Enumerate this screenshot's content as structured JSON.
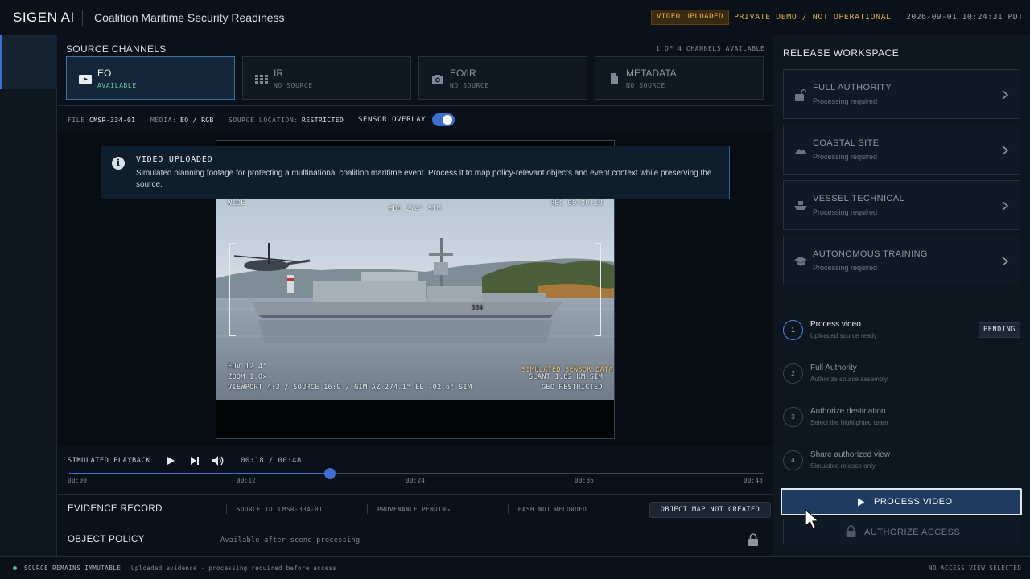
{
  "header": {
    "brand": "SIGEN AI",
    "title": "Coalition Maritime Security Readiness",
    "status_badge": "VIDEO UPLOADED",
    "demo_label": "PRIVATE DEMO / NOT OPERATIONAL",
    "timestamp": "2026-09-01 10:24:31 PDT"
  },
  "channels": {
    "title": "SOURCE CHANNELS",
    "available": "1 OF 4 CHANNELS AVAILABLE",
    "items": [
      {
        "name": "EO",
        "status": "AVAILABLE",
        "icon": "video-icon"
      },
      {
        "name": "IR",
        "status": "NO SOURCE",
        "icon": "grid-icon"
      },
      {
        "name": "EO/IR",
        "status": "NO SOURCE",
        "icon": "camera-icon"
      },
      {
        "name": "METADATA",
        "status": "NO SOURCE",
        "icon": "document-icon"
      }
    ]
  },
  "infobar": {
    "file_label": "FILE",
    "file": "CMSR-334-01",
    "media_label": "MEDIA:",
    "media": "EO / RGB",
    "location_label": "SOURCE LOCATION:",
    "location": "RESTRICTED",
    "overlay_label": "SENSOR OVERLAY",
    "overlay_on": true
  },
  "notice": {
    "title": "VIDEO UPLOADED",
    "body": "Simulated planning footage for protecting a multinational coalition maritime event. Process it to map policy-relevant objects and event context while preserving the source."
  },
  "hud": {
    "top_left": "WIDE",
    "top_center": "HDG 274° SIM",
    "top_right": "REC 00:00:18",
    "fov": "FOV 12.4°",
    "zoom": "ZOOM 1.0×",
    "viewport": "VIEWPORT 4:3 / SOURCE 16:9 / GIM AZ 274.1° EL -02.6° SIM",
    "sim_data": "SIMULATED SENSOR DATA",
    "slant": "SLANT 1.82 KM SIM",
    "geo": "GEO RESTRICTED",
    "hull_number": "334"
  },
  "playback": {
    "label": "SIMULATED PLAYBACK",
    "time": "00:18 / 00:48",
    "progress": 0.375,
    "ticks": [
      "00:00",
      "00:12",
      "00:24",
      "00:36",
      "00:48"
    ]
  },
  "evidence": {
    "title": "EVIDENCE RECORD",
    "source_id_label": "SOURCE ID",
    "source_id": "CMSR-334-01",
    "provenance": "PROVENANCE PENDING",
    "hash": "HASH NOT RECORDED",
    "badge": "OBJECT MAP NOT CREATED"
  },
  "policy": {
    "title": "OBJECT POLICY",
    "note": "Available after scene processing"
  },
  "workspace": {
    "title": "RELEASE WORKSPACE",
    "cards": [
      {
        "name": "FULL AUTHORITY",
        "sub": "Processing required",
        "icon": "unlock-icon"
      },
      {
        "name": "COASTAL SITE",
        "sub": "Processing required",
        "icon": "terrain-icon"
      },
      {
        "name": "VESSEL TECHNICAL",
        "sub": "Processing required",
        "icon": "ship-icon"
      },
      {
        "name": "AUTONOMOUS TRAINING",
        "sub": "Processing required",
        "icon": "graduation-cap-icon"
      }
    ],
    "steps": [
      {
        "num": "1",
        "title": "Process video",
        "sub": "Uploaded source ready"
      },
      {
        "num": "2",
        "title": "Full Authority",
        "sub": "Authorize source assembly"
      },
      {
        "num": "3",
        "title": "Authorize destination",
        "sub": "Select the highlighted team"
      },
      {
        "num": "4",
        "title": "Share authorized view",
        "sub": "Simulated release only"
      }
    ],
    "pending": "PENDING",
    "process_label": "PROCESS VIDEO",
    "authorize_label": "AUTHORIZE ACCESS"
  },
  "statusbar": {
    "left": "SOURCE REMAINS IMMUTABLE",
    "middle": "Uploaded evidence · processing required before access",
    "right": "NO ACCESS VIEW SELECTED"
  },
  "colors": {
    "accent": "#3f6dd0",
    "amber": "#d9a84a",
    "available": "#6fc6a0"
  }
}
